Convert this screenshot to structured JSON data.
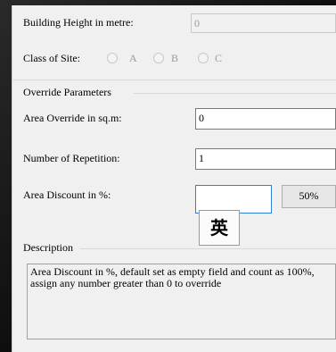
{
  "building_height": {
    "label": "Building Height in metre:",
    "value": "0"
  },
  "class_of_site": {
    "label": "Class of Site:",
    "options": [
      "A",
      "B",
      "C"
    ]
  },
  "override_params": {
    "title": "Override Parameters",
    "area_override": {
      "label": "Area Override in sq.m:",
      "value": "0"
    },
    "repetition": {
      "label": "Number of Repetition:",
      "value": "1"
    },
    "discount": {
      "label": "Area Discount in %:",
      "value": "",
      "button_label": "50%"
    }
  },
  "ime_indicator": "英",
  "description": {
    "title": "Description",
    "text": "Area Discount in %, default set as empty field and count as 100%, assign any number greater than 0 to override"
  }
}
